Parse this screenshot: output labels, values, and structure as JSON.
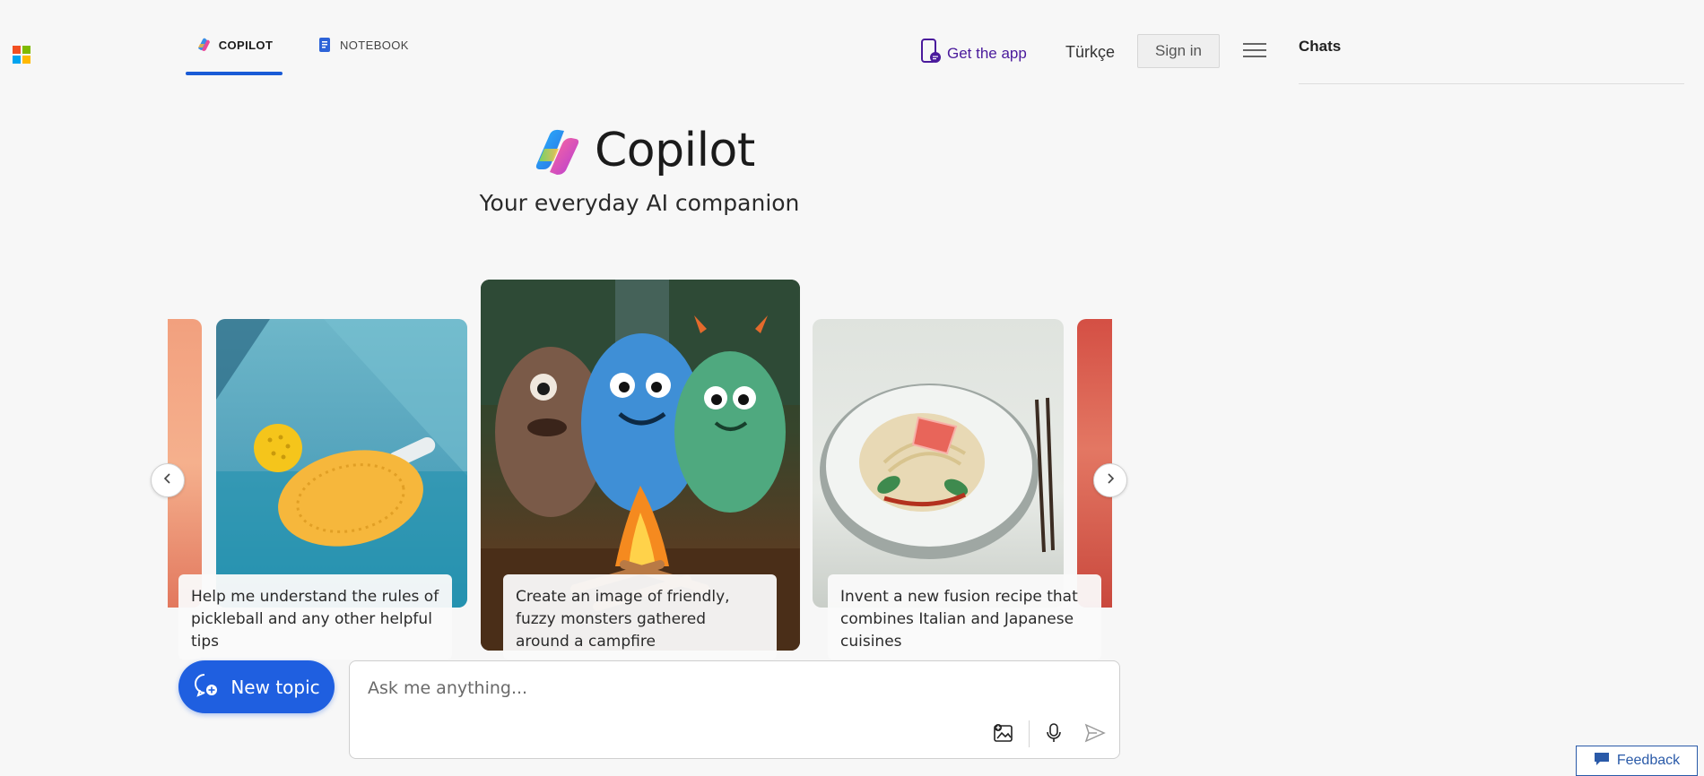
{
  "header": {
    "tabs": [
      {
        "label": "COPILOT",
        "icon": "copilot-icon",
        "active": true
      },
      {
        "label": "NOTEBOOK",
        "icon": "notebook-icon",
        "active": false
      }
    ],
    "get_app": "Get the app",
    "language": "Türkçe",
    "sign_in": "Sign in"
  },
  "sidebar": {
    "title": "Chats"
  },
  "hero": {
    "title": "Copilot",
    "subtitle": "Your everyday AI companion"
  },
  "carousel": {
    "cards": [
      {
        "caption": "Help me understand the rules of pickleball and any other helpful tips",
        "image": "pickleball"
      },
      {
        "caption": "Create an image of friendly, fuzzy monsters gathered around a campfire",
        "image": "monsters-campfire"
      },
      {
        "caption": "Invent a new fusion recipe that combines Italian and Japanese cuisines",
        "image": "fusion-dish"
      }
    ]
  },
  "composer": {
    "new_topic": "New topic",
    "placeholder": "Ask me anything..."
  },
  "feedback": "Feedback",
  "colors": {
    "accent": "#1f5fe0",
    "tab_underline": "#1a5bd6",
    "get_app": "#4a1a9c",
    "background": "#f7f7f7"
  }
}
